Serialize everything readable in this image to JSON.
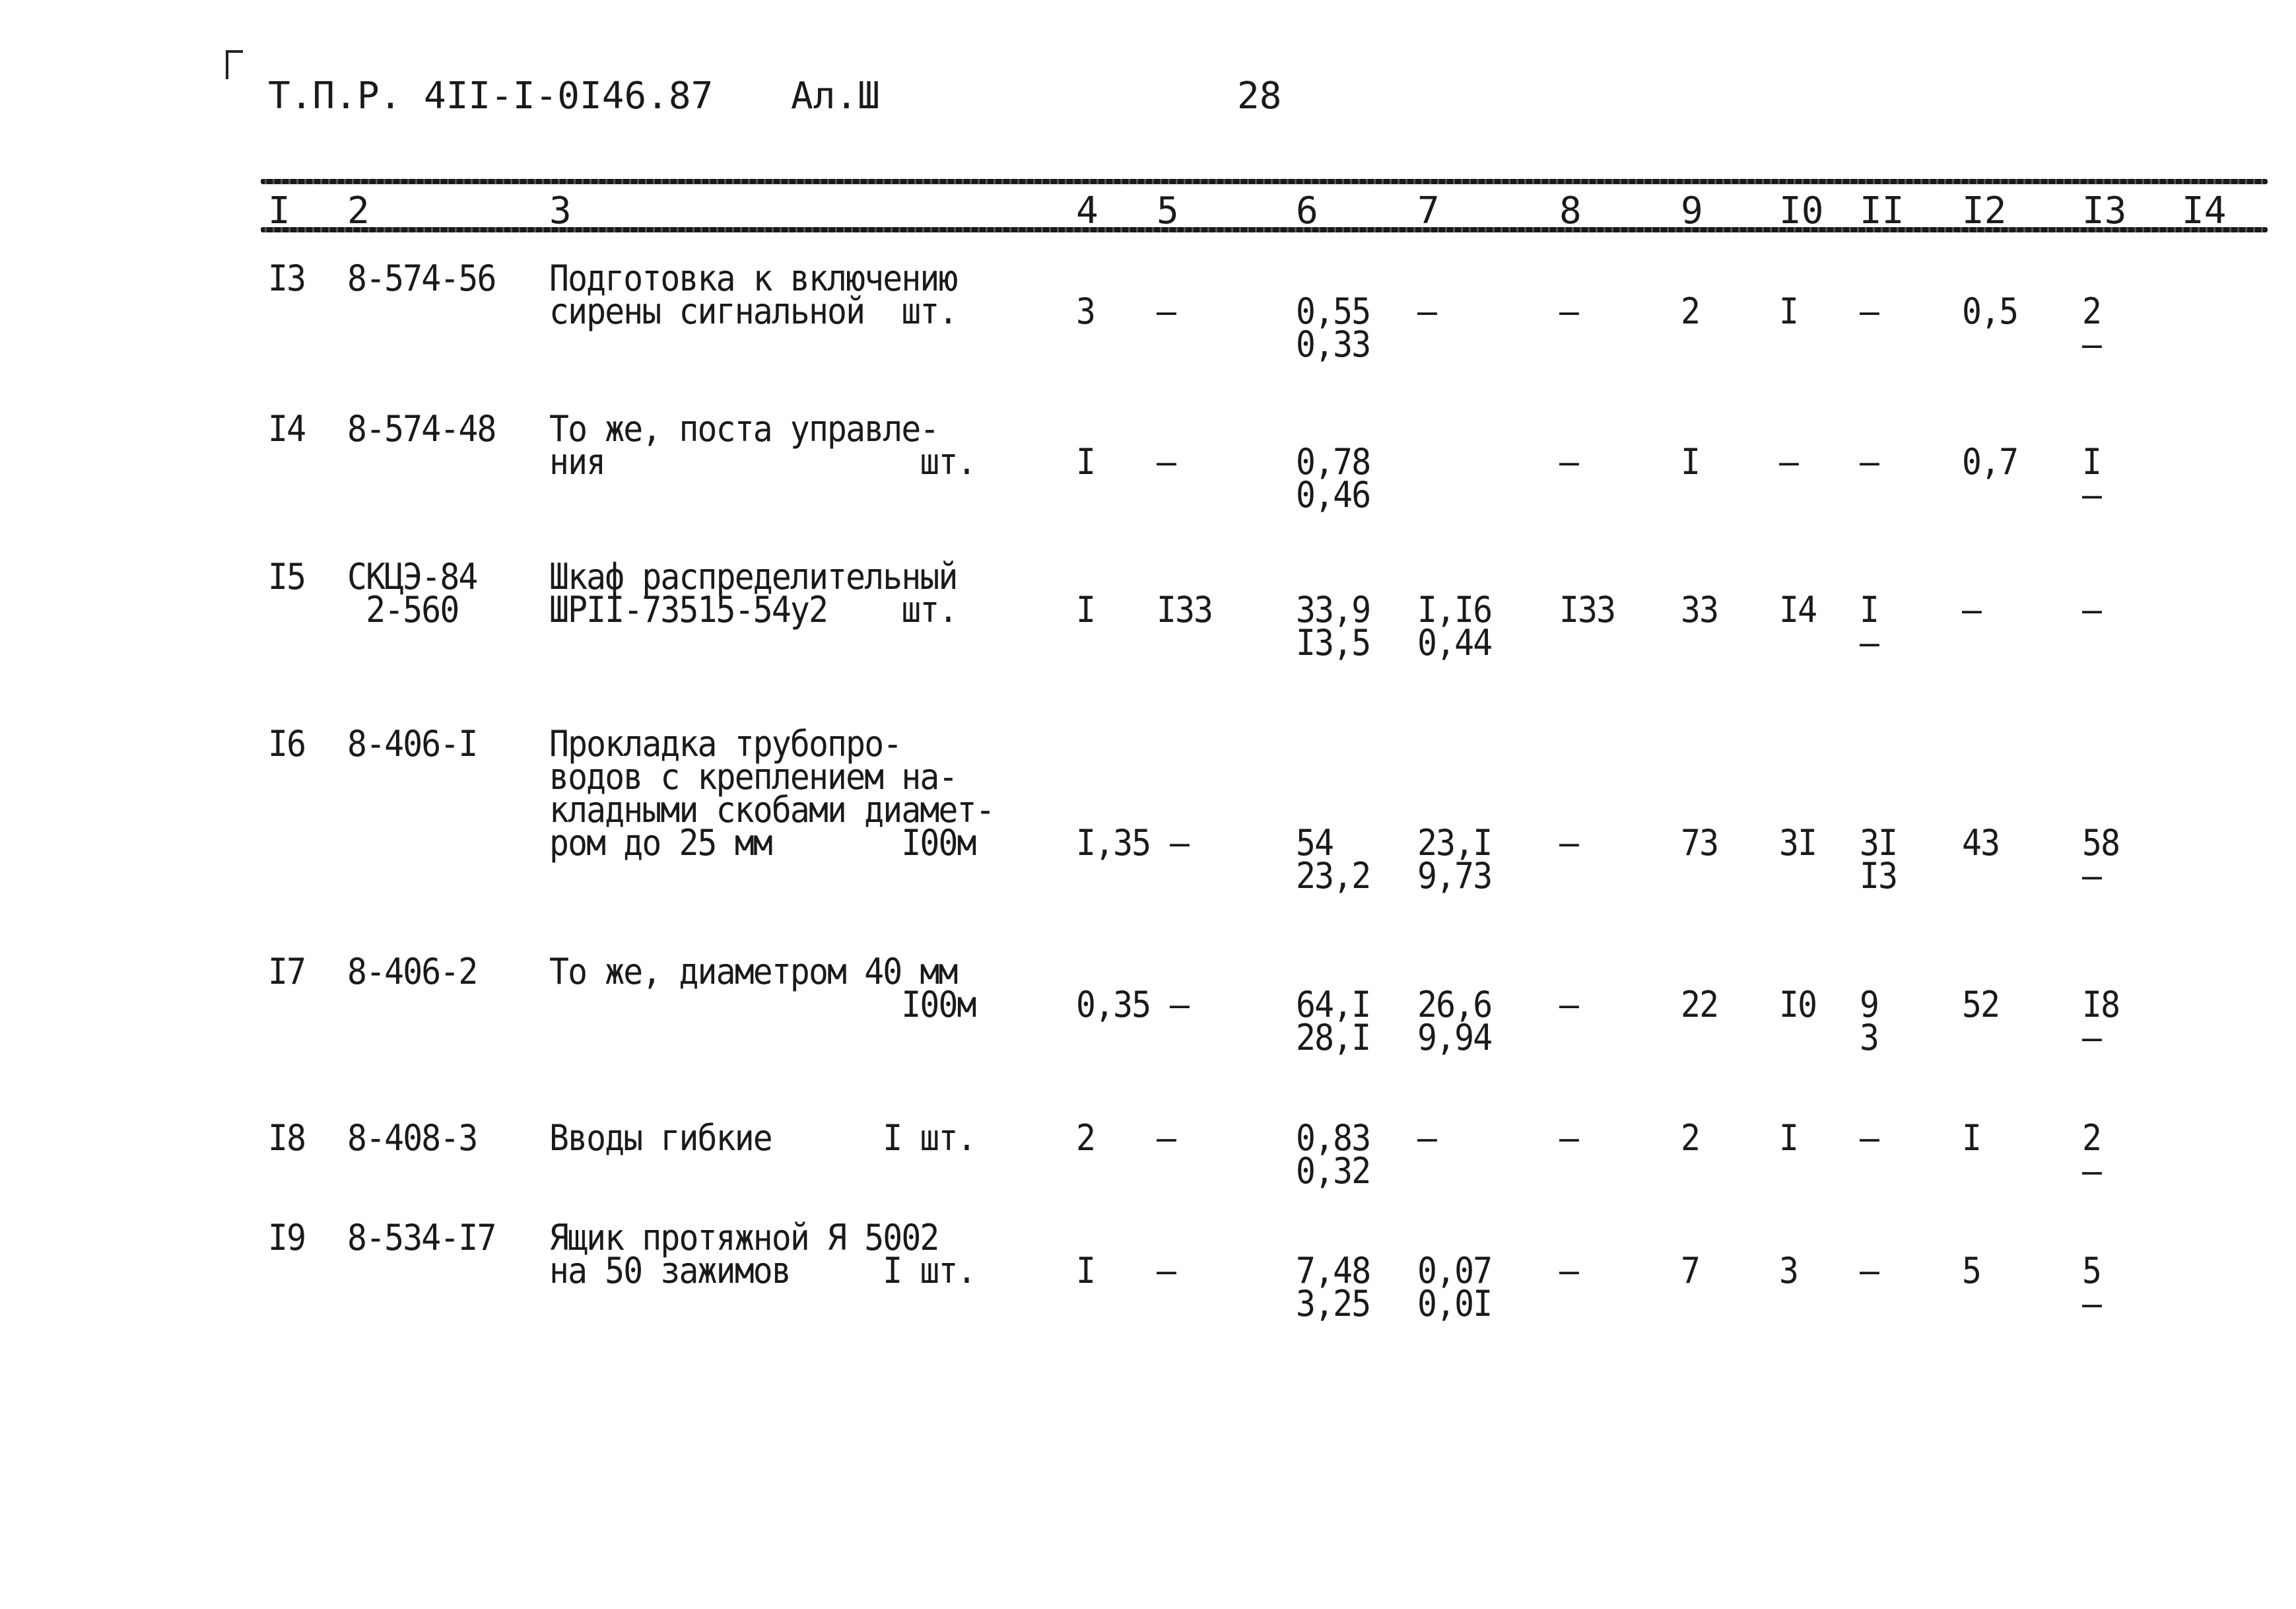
{
  "header": {
    "doc_code": "Т.П.Р. 4II-I-0I46.87",
    "album": "Ал.Ш",
    "page_number": "28"
  },
  "columns": [
    "I",
    "2",
    "3",
    "4",
    "5",
    "6",
    "7",
    "8",
    "9",
    "I0",
    "II",
    "I2",
    "I3",
    "I4"
  ],
  "rows": [
    {
      "n": "I3",
      "code": [
        "8-574-56"
      ],
      "desc": [
        "Подготовка к включению",
        "сирены сигнальной  шт."
      ],
      "c4": "3",
      "c5": "–",
      "c6": [
        "0,55",
        "0,33"
      ],
      "c7": [
        "–",
        ""
      ],
      "c8": "–",
      "c9": "2",
      "c10": "I",
      "c11": [
        "–",
        ""
      ],
      "c12": "0,5",
      "c13": [
        "2",
        "–"
      ],
      "c14": ""
    },
    {
      "n": "I4",
      "code": [
        "8-574-48"
      ],
      "desc": [
        "То же, поста управле-",
        "ния                 шт."
      ],
      "c4": "I",
      "c5": "–",
      "c6": [
        "0,78",
        "0,46"
      ],
      "c7": [
        "",
        ""
      ],
      "c8": "–",
      "c9": "I",
      "c10": "–",
      "c11": [
        "–",
        ""
      ],
      "c12": "0,7",
      "c13": [
        "I",
        "–"
      ],
      "c14": ""
    },
    {
      "n": "I5",
      "code": [
        "СКЦЭ-84",
        " 2-560"
      ],
      "desc": [
        "Шкаф распределительный",
        "ШРII-73515-54у2    шт."
      ],
      "c4": "I",
      "c5": "I33",
      "c6": [
        "33,9",
        "I3,5"
      ],
      "c7": [
        "I,I6",
        "0,44"
      ],
      "c8": "I33",
      "c9": "33",
      "c10": "I4",
      "c11": [
        "I",
        "–"
      ],
      "c12": "–",
      "c13": [
        "–",
        ""
      ],
      "c14": ""
    },
    {
      "n": "I6",
      "code": [
        "8-406-I"
      ],
      "desc": [
        "Прокладка трубопро-",
        "водов с креплением на-",
        "кладными скобами диамет-",
        "ром до 25 мм       I00м"
      ],
      "c4": "I,35",
      "c5": "–",
      "c6": [
        "54",
        "23,2"
      ],
      "c7": [
        "23,I",
        "9,73"
      ],
      "c8": "–",
      "c9": "73",
      "c10": "3I",
      "c11": [
        "3I",
        "I3"
      ],
      "c12": "43",
      "c13": [
        "58",
        "–"
      ],
      "c14": ""
    },
    {
      "n": "I7",
      "code": [
        "8-406-2"
      ],
      "desc": [
        "То же, диаметром 40 мм",
        "                   I00м"
      ],
      "c4": "0,35",
      "c5": "–",
      "c6": [
        "64,I",
        "28,I"
      ],
      "c7": [
        "26,6",
        "9,94"
      ],
      "c8": "–",
      "c9": "22",
      "c10": "I0",
      "c11": [
        "9",
        "3"
      ],
      "c12": "52",
      "c13": [
        "I8",
        "–"
      ],
      "c14": ""
    },
    {
      "n": "I8",
      "code": [
        "8-408-3"
      ],
      "desc": [
        "Вводы гибкие      I шт."
      ],
      "c4": "2",
      "c5": "–",
      "c6": [
        "0,83",
        "0,32"
      ],
      "c7": [
        "–",
        ""
      ],
      "c8": "–",
      "c9": "2",
      "c10": "I",
      "c11": [
        "–",
        ""
      ],
      "c12": "I",
      "c13": [
        "2",
        "–"
      ],
      "c14": ""
    },
    {
      "n": "I9",
      "code": [
        "8-534-I7"
      ],
      "desc": [
        "Ящик протяжной Я 5002",
        "на 50 зажимов     I шт."
      ],
      "c4": "I",
      "c5": "–",
      "c6": [
        "7,48",
        "3,25"
      ],
      "c7": [
        "0,07",
        "0,0I"
      ],
      "c8": "–",
      "c9": "7",
      "c10": "3",
      "c11": [
        "–",
        ""
      ],
      "c12": "5",
      "c13": [
        "5",
        "–"
      ],
      "c14": ""
    }
  ]
}
